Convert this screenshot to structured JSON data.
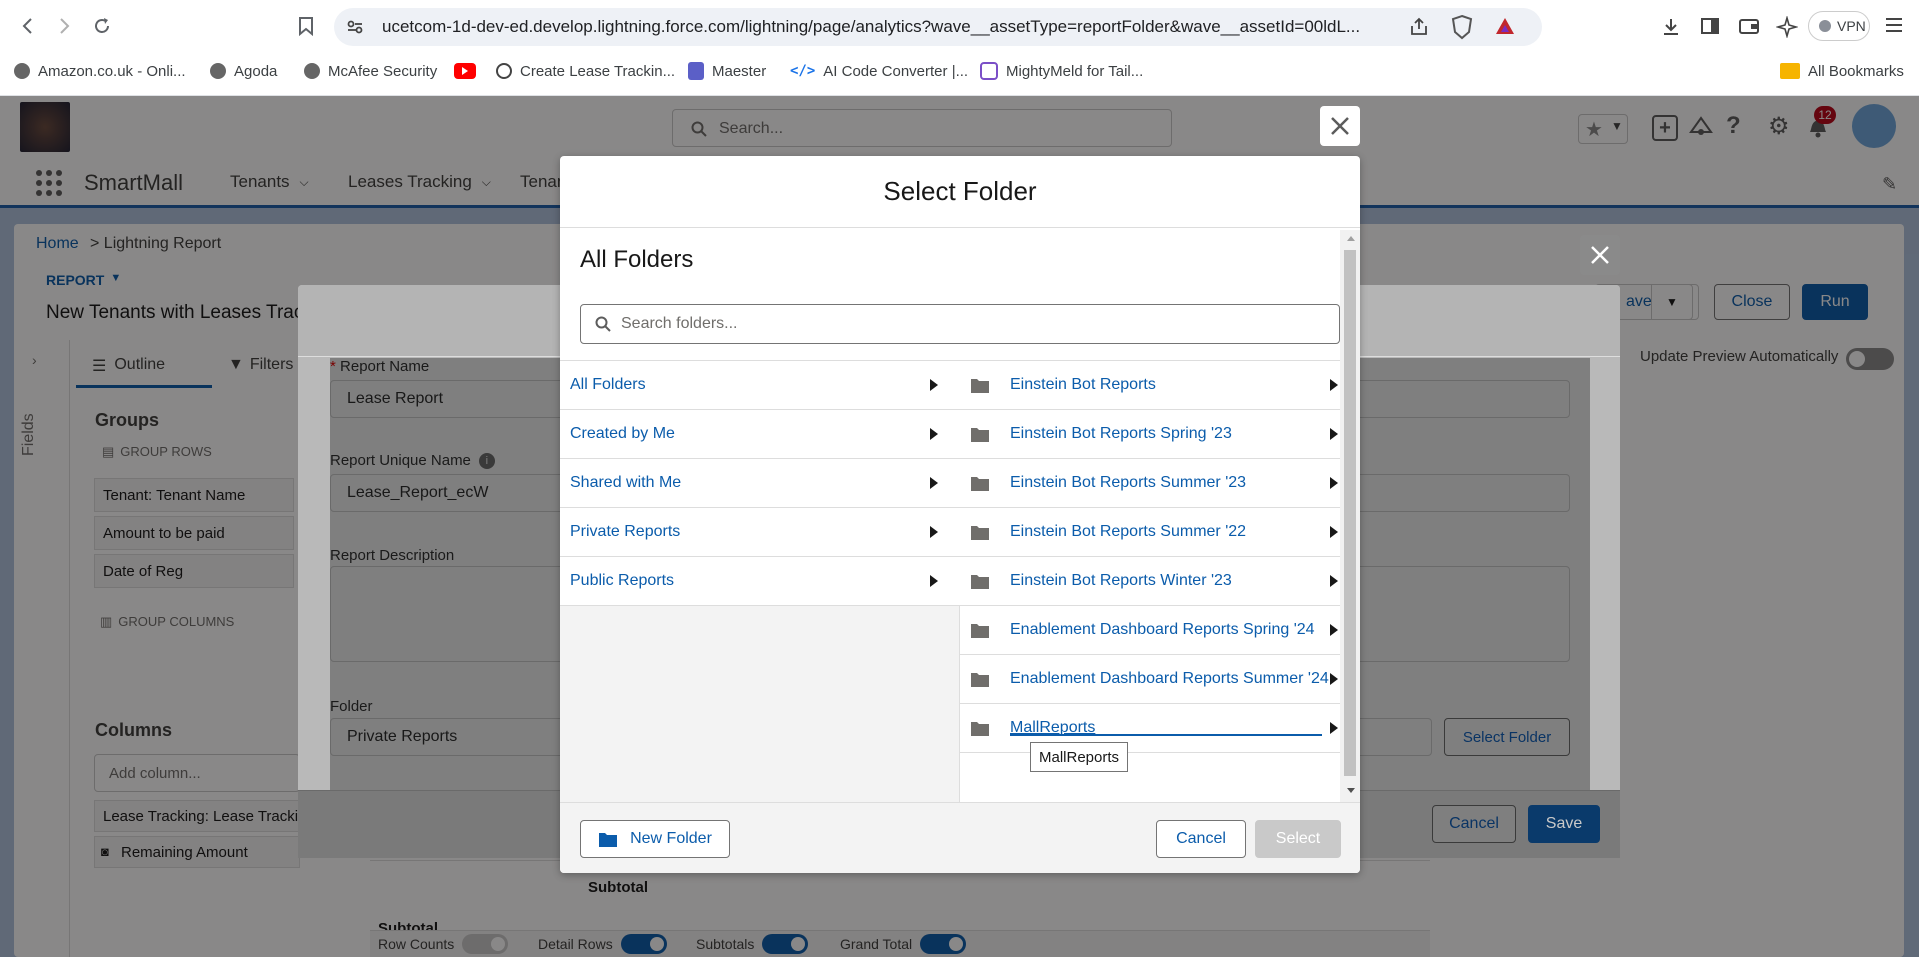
{
  "browser": {
    "url": "ucetcom-1d-dev-ed.develop.lightning.force.com/lightning/page/analytics?wave__assetType=reportFolder&wave__assetId=00ldL...",
    "vpn_label": "VPN",
    "bookmarks": [
      {
        "label": "Amazon.co.uk - Onli...",
        "icon": "globe-icon"
      },
      {
        "label": "Agoda",
        "icon": "globe-icon"
      },
      {
        "label": "McAfee Security",
        "icon": "globe-icon"
      },
      {
        "label": "",
        "icon": "youtube-icon"
      },
      {
        "label": "Create Lease Trackin...",
        "icon": "openai-icon"
      },
      {
        "label": "Maester",
        "icon": "shield-icon"
      },
      {
        "label": "AI Code Converter |...",
        "icon": "code-icon"
      },
      {
        "label": "MightyMeld for Tail...",
        "icon": "mightymeld-icon"
      }
    ],
    "all_bookmarks": "All Bookmarks"
  },
  "sf": {
    "search_placeholder": "Search...",
    "app_name": "SmartMall",
    "nav_items": [
      "Tenants",
      "Leases Tracking",
      "Tenan"
    ],
    "notification_count": "12",
    "breadcrumb_home": "Home",
    "breadcrumb_current": "> Lightning Report",
    "report_label": "REPORT",
    "report_title": "New Tenants with Leases Trac",
    "buttons": {
      "save": "ave",
      "close": "Close",
      "run": "Run"
    },
    "update_preview": "Update Preview Automatically",
    "fields_tab": "Fields",
    "outline_tab": "Outline",
    "filters_tab": "Filters",
    "groups_title": "Groups",
    "group_rows_label": "GROUP ROWS",
    "group_rows": [
      "Tenant: Tenant Name",
      "Amount to be paid",
      "Date of Reg"
    ],
    "group_columns_label": "GROUP COLUMNS",
    "columns_title": "Columns",
    "add_column_placeholder": "Add column...",
    "columns": [
      "Lease Tracking: Lease Trackin",
      "Remaining Amount"
    ],
    "subtotal": "Subtotal",
    "subtotal2": "Subtotal",
    "toggles": [
      "Row Counts",
      "Detail Rows",
      "Subtotals",
      "Grand Total"
    ]
  },
  "save_modal": {
    "report_name_label": "Report Name",
    "report_name_value": "Lease Report",
    "unique_name_label": "Report Unique Name",
    "unique_name_value": "Lease_Report_ecW",
    "description_label": "Report Description",
    "folder_label": "Folder",
    "folder_value": "Private Reports",
    "select_folder_btn": "Select Folder",
    "cancel_btn": "Cancel",
    "save_btn": "Save"
  },
  "folder_modal": {
    "title": "Select Folder",
    "section_title": "All Folders",
    "search_placeholder": "Search folders...",
    "left_items": [
      "All Folders",
      "Created by Me",
      "Shared with Me",
      "Private Reports",
      "Public Reports"
    ],
    "right_items": [
      "Einstein Bot Reports",
      "Einstein Bot Reports Spring '23",
      "Einstein Bot Reports Summer '23",
      "Einstein Bot Reports Summer '22",
      "Einstein Bot Reports Winter '23",
      "Enablement Dashboard Reports Spring '24",
      "Enablement Dashboard Reports Summer '24",
      "MallReports"
    ],
    "tooltip": "MallReports",
    "new_folder_btn": "New Folder",
    "cancel_btn": "Cancel",
    "select_btn": "Select"
  },
  "colors": {
    "brand": "#0b5cab",
    "link": "#0b5cab",
    "overlay": "rgba(8,7,7,0.48)",
    "nav_border": "#1b5eab"
  }
}
